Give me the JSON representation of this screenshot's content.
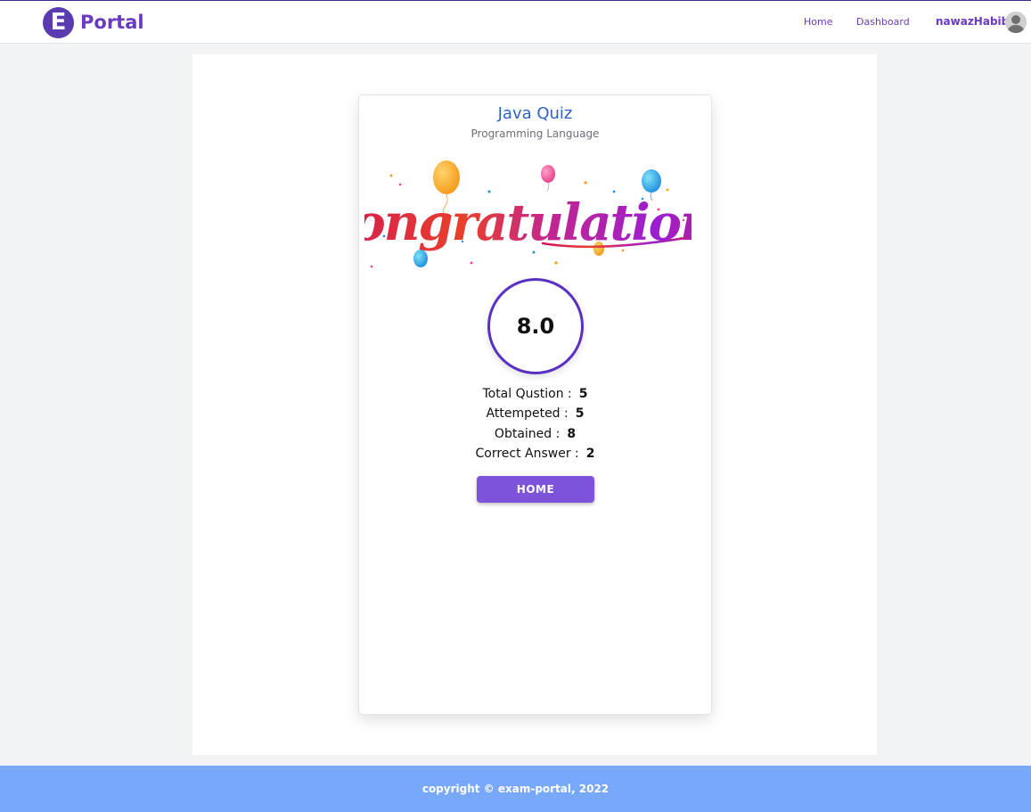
{
  "navbar": {
    "logo_letter": "E",
    "brand": "Portal",
    "links": [
      {
        "label": "Home"
      },
      {
        "label": "Dashboard"
      }
    ],
    "username": "nawazHabib",
    "brand_color": "#6a3ac0"
  },
  "quiz": {
    "title": "Java Quiz",
    "category": "Programming Language",
    "banner_text": "Congratulations",
    "score": "8.0",
    "stats": [
      {
        "label": "Total Qustion :",
        "value": "5"
      },
      {
        "label": "Attempeted :",
        "value": "5"
      },
      {
        "label": "Obtained :",
        "value": "8"
      },
      {
        "label": "Correct Answer :",
        "value": "2"
      }
    ],
    "home_button": "HOME"
  },
  "footer": {
    "text": "copyright © exam-portal, 2022"
  },
  "colors": {
    "accent": "#7d54d9",
    "title_blue": "#2d63c8",
    "footer_bg": "#77a8f9",
    "page_bg": "#f2f3f5"
  }
}
